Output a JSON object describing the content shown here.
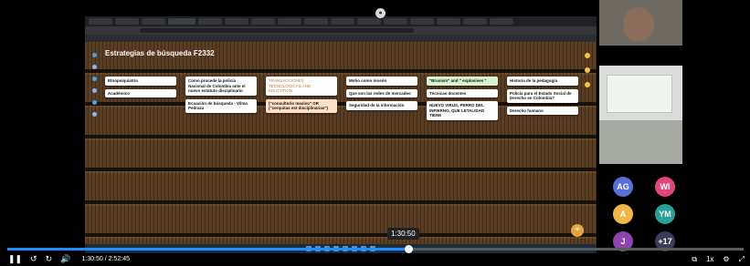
{
  "colors": {
    "accent": "#1e90ff",
    "fab": "#e8a33a"
  },
  "board": {
    "title": "Estrategias de búsqueda F2332",
    "subtitle": ""
  },
  "columns": [
    {
      "cards": [
        {
          "title": "Etnopsiquiatría",
          "body": "",
          "style": "white"
        },
        {
          "title": "Académico",
          "body": "",
          "style": "white"
        }
      ]
    },
    {
      "cards": [
        {
          "title": "Como procede la policía Nacional de Colombia ante el nuevo estatuto disciplinario",
          "body": "",
          "style": "white"
        },
        {
          "title": "Ecuación de búsqueda - Vilma Pedraza",
          "body": "",
          "style": "white"
        }
      ]
    },
    {
      "cards": [
        {
          "title": "TRANSACCIONES TECNOLÓGICAS AND EDUCATION",
          "body": "",
          "style": "white",
          "muted": true
        },
        {
          "title": "(\"consultorio masivo\" OR (\"cerquitas est disciplinarias\")",
          "body": "",
          "style": "orange"
        }
      ]
    },
    {
      "cards": [
        {
          "title": "Moho como mosón",
          "body": "",
          "style": "white"
        },
        {
          "title": "Que son las redes de mercadeo",
          "body": "",
          "style": "white"
        },
        {
          "title": "Seguridad de la información",
          "body": "",
          "style": "white"
        }
      ]
    },
    {
      "cards": [
        {
          "title": "\"Bruxism\" and \" explosives \"",
          "body": "",
          "style": "green"
        },
        {
          "title": "Técnicas docentes",
          "body": "",
          "style": "white"
        },
        {
          "title": "NUEVO VIRUS, PERRO DEL INFIERNO, QUE LETALIDAD TIENE",
          "body": "",
          "style": "white"
        }
      ]
    },
    {
      "cards": [
        {
          "title": "Historia de la pedagogía",
          "body": "",
          "style": "white"
        },
        {
          "title": "Policía para el Estado Social de Derecho en Colombia?",
          "body": "",
          "style": "white"
        },
        {
          "title": "Derecho humano",
          "body": "",
          "style": "white"
        }
      ]
    }
  ],
  "participants": [
    {
      "initials": "AG",
      "name": "",
      "color": "#5a6fd6"
    },
    {
      "initials": "WI",
      "name": "",
      "color": "#e0457b"
    },
    {
      "initials": "A",
      "name": "",
      "color": "#f0b64a"
    },
    {
      "initials": "YM",
      "name": "",
      "color": "#2aa198"
    },
    {
      "initials": "J",
      "name": "",
      "color": "#8e44ad"
    },
    {
      "initials": "+17",
      "name": "",
      "color": "#3a3d55"
    }
  ],
  "player": {
    "progress": 0.545,
    "tooltip_time": "1:30:50",
    "current_time": "1:30:50",
    "separator": "/",
    "duration": "2:52:45",
    "speed": "1x"
  }
}
